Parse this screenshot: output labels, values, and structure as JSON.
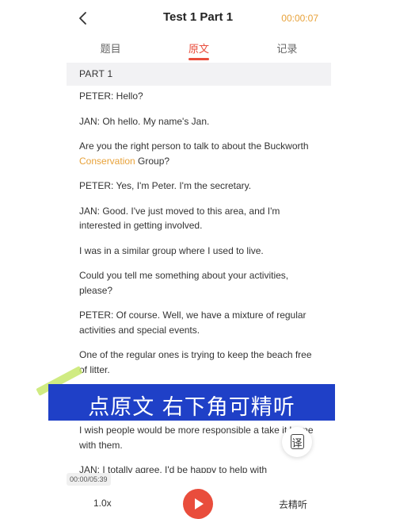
{
  "header": {
    "title": "Test 1 Part 1",
    "timer": "00:00:07",
    "accent_color": "#e8a23a",
    "back_icon": "chevron-left-icon"
  },
  "tabs": [
    {
      "label": "题目",
      "active": false
    },
    {
      "label": "原文",
      "active": true
    },
    {
      "label": "记录",
      "active": false
    }
  ],
  "active_tab_color": "#e94d3c",
  "transcript": {
    "part_label": "PART 1",
    "paragraphs": [
      "PETER: Hello?",
      "JAN: Oh hello. My name's Jan.",
      {
        "before": "Are you the right person to talk to about the Buckworth ",
        "highlight": "Conservation",
        "after": " Group?"
      },
      "PETER: Yes, I'm Peter. I'm the secretary.",
      "JAN: Good. I've just moved to this area, and I'm interested in getting involved.",
      "I was in a similar group where I used to live.",
      "Could you tell me something about your activities, please?",
      "PETER: Of course. Well, we have a mixture of regular activities and special events.",
      "One of the regular ones is trying to keep the beach free of litter.",
      "I wish people would be more responsible a take it home with them.",
      "JAN: I totally agree. I'd be happy to help with"
    ]
  },
  "overlay": {
    "text": "点原文 右下角可精听",
    "color": "#1f40c7"
  },
  "translate_button": {
    "label": "译"
  },
  "player": {
    "time": "00:00/05:39",
    "speed": "1.0x",
    "play_icon": "play-icon",
    "precise_label": "去精听"
  }
}
